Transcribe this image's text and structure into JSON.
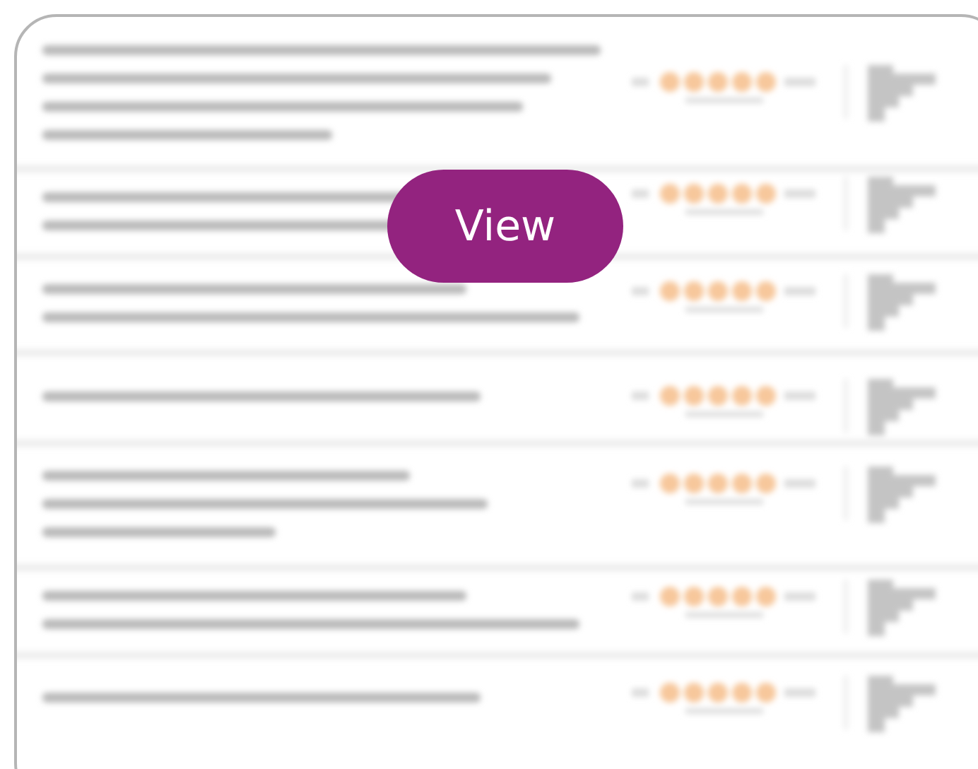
{
  "button": {
    "label": "View"
  }
}
